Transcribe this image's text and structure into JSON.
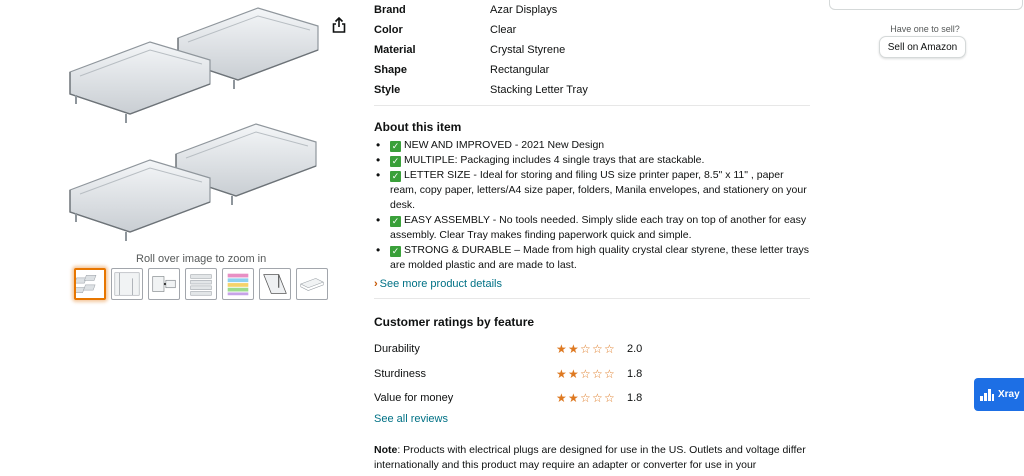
{
  "product_images": {
    "zoom_hint": "Roll over image to zoom in",
    "share_icon": "share-icon",
    "thumbnail_count": 7
  },
  "specs": [
    {
      "key": "Brand",
      "value": "Azar Displays"
    },
    {
      "key": "Color",
      "value": "Clear"
    },
    {
      "key": "Material",
      "value": "Crystal Styrene"
    },
    {
      "key": "Shape",
      "value": "Rectangular"
    },
    {
      "key": "Style",
      "value": "Stacking Letter Tray"
    }
  ],
  "about": {
    "title": "About this item",
    "bullets": [
      "NEW AND IMPROVED - 2021 New Design",
      "MULTIPLE: Packaging includes 4 single trays that are stackable.",
      "LETTER SIZE - Ideal for storing and filing US size printer paper, 8.5\" x 11\" , paper ream, copy paper, letters/A4 size paper, folders, Manila envelopes, and stationery on your desk.",
      "EASY ASSEMBLY - No tools needed. Simply slide each tray on top of another for easy assembly. Clear Tray makes finding paperwork quick and simple.",
      "STRONG & DURABLE – Made from high quality crystal clear styrene, these letter trays are molded plastic and are made to last."
    ],
    "see_more": "See more product details"
  },
  "ratings": {
    "title": "Customer ratings by feature",
    "items": [
      {
        "label": "Durability",
        "value": "2.0",
        "stars": 2.0
      },
      {
        "label": "Sturdiness",
        "value": "1.8",
        "stars": 1.8
      },
      {
        "label": "Value for money",
        "value": "1.8",
        "stars": 1.8
      }
    ],
    "see_all": "See all reviews"
  },
  "note": {
    "label": "Note",
    "text": ": Products with electrical plugs are designed for use in the US. Outlets and voltage differ internationally and this product may require an adapter or converter for use in your"
  },
  "sell": {
    "hint": "Have one to sell?",
    "button": "Sell on Amazon"
  },
  "xray": {
    "label": "Xray",
    "icon": "xray-icon"
  },
  "colors": {
    "link": "#007185",
    "star": "#de7921",
    "thumb_active": "#e77600",
    "check": "#3aa03a",
    "xray": "#1d6fe5"
  }
}
